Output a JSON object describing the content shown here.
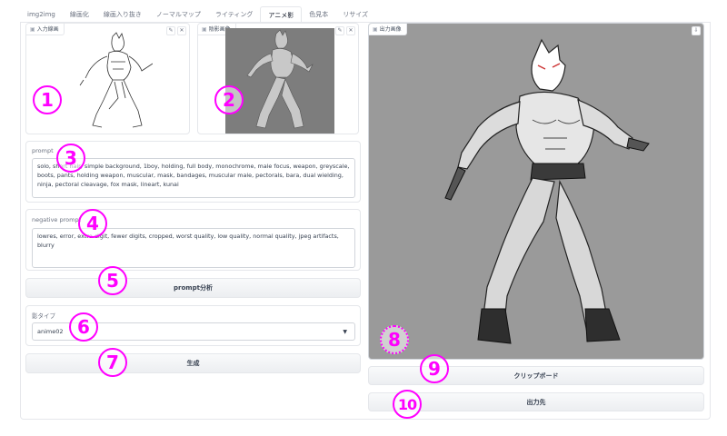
{
  "tabs": [
    {
      "label": "img2img",
      "active": false
    },
    {
      "label": "線画化",
      "active": false
    },
    {
      "label": "線画入り抜き",
      "active": false
    },
    {
      "label": "ノーマルマップ",
      "active": false
    },
    {
      "label": "ライティング",
      "active": false
    },
    {
      "label": "アニメ影",
      "active": true
    },
    {
      "label": "色見本",
      "active": false
    },
    {
      "label": "リサイズ",
      "active": false
    }
  ],
  "input_image": {
    "label": "入力線画",
    "edit_icon": "pencil-icon",
    "clear_icon": "close-icon"
  },
  "shadow_image": {
    "label": "陰影画像",
    "edit_icon": "pencil-icon",
    "clear_icon": "close-icon"
  },
  "output_image": {
    "label": "出力画像",
    "download_icon": "download-icon"
  },
  "prompt": {
    "label": "prompt",
    "value": "solo, short hair, simple background, 1boy, holding, full body, monochrome, male focus, weapon, greyscale, boots, pants, holding weapon, muscular, mask, bandages, muscular male, pectorals, bara, dual wielding, ninja, pectoral cleavage, fox mask, lineart, kunai"
  },
  "negative_prompt": {
    "label": "negative prompt",
    "value": "lowres, error, extra digit, fewer digits, cropped, worst quality, low quality, normal quality, jpeg artifacts, blurry"
  },
  "analyze_button": "prompt分析",
  "shadow_type": {
    "label": "影タイプ",
    "value": "anime02"
  },
  "generate_button": "生成",
  "clipboard_button": "クリップボード",
  "output_dest_button": "出力先",
  "badges": [
    "1",
    "2",
    "3",
    "4",
    "5",
    "6",
    "7",
    "8",
    "9",
    "10"
  ],
  "colors": {
    "annotation": "#ff00ff",
    "output_bg": "#9a9a9a",
    "shadow_bg": "#7d7d7d"
  }
}
